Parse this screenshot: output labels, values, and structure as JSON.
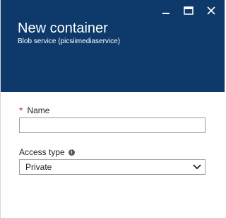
{
  "header": {
    "title": "New container",
    "subtitle": "Blob service (picsiimediaservice)",
    "background_color": "#0d3a6b"
  },
  "window_controls": {
    "minimize_icon": "minimize-icon",
    "maximize_icon": "maximize-icon",
    "close_icon": "close-icon"
  },
  "form": {
    "name": {
      "required_marker": "*",
      "label": "Name",
      "value": ""
    },
    "access_type": {
      "label": "Access type",
      "info_icon_glyph": "i",
      "selected": "Private"
    }
  }
}
